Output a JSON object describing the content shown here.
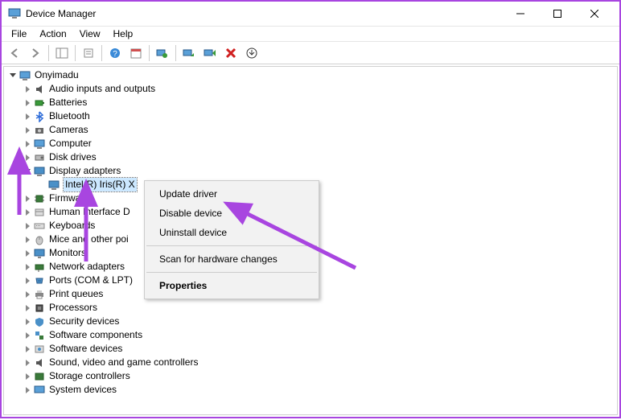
{
  "window": {
    "title": "Device Manager"
  },
  "menu": {
    "file": "File",
    "action": "Action",
    "view": "View",
    "help": "Help"
  },
  "tree": {
    "root": "Onyimadu",
    "items": [
      "Audio inputs and outputs",
      "Batteries",
      "Bluetooth",
      "Cameras",
      "Computer",
      "Disk drives",
      "Display adapters",
      "Firmware",
      "Human Interface D",
      "Keyboards",
      "Mice and other poi",
      "Monitors",
      "Network adapters",
      "Ports (COM & LPT)",
      "Print queues",
      "Processors",
      "Security devices",
      "Software components",
      "Software devices",
      "Sound, video and game controllers",
      "Storage controllers",
      "System devices"
    ],
    "display_child": "Intel(R) Iris(R) X"
  },
  "context": {
    "update": "Update driver",
    "disable": "Disable device",
    "uninstall": "Uninstall device",
    "scan": "Scan for hardware changes",
    "properties": "Properties"
  }
}
